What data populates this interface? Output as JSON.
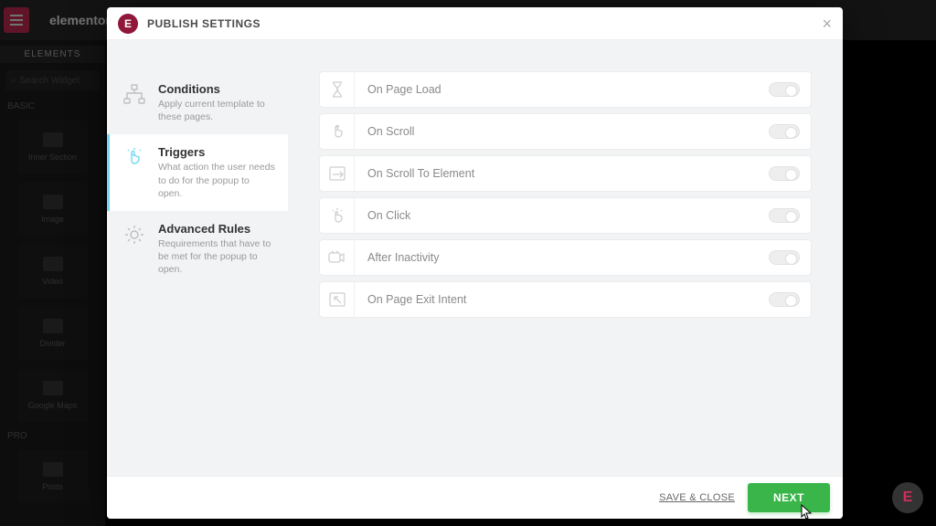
{
  "backdrop": {
    "brand": "elementor",
    "panel_tab": "ELEMENTS",
    "search_placeholder": "Search Widget",
    "cat_basic": "BASIC",
    "cat_pro": "PRO",
    "widgets_basic": [
      "Inner Section",
      "Image",
      "Video",
      "Divider",
      "Google Maps"
    ],
    "widgets_pro": [
      "Posts"
    ]
  },
  "modal": {
    "title": "PUBLISH SETTINGS"
  },
  "nav": [
    {
      "key": "conditions",
      "title": "Conditions",
      "desc": "Apply current template to these pages."
    },
    {
      "key": "triggers",
      "title": "Triggers",
      "desc": "What action the user needs to do for the popup to open."
    },
    {
      "key": "advanced-rules",
      "title": "Advanced Rules",
      "desc": "Requirements that have to be met for the popup to open."
    }
  ],
  "active_nav": "triggers",
  "triggers": [
    {
      "key": "page-load",
      "label": "On Page Load",
      "on": false
    },
    {
      "key": "scroll",
      "label": "On Scroll",
      "on": false
    },
    {
      "key": "scroll-element",
      "label": "On Scroll To Element",
      "on": false
    },
    {
      "key": "click",
      "label": "On Click",
      "on": false
    },
    {
      "key": "inactivity",
      "label": "After Inactivity",
      "on": false
    },
    {
      "key": "exit-intent",
      "label": "On Page Exit Intent",
      "on": false
    }
  ],
  "footer": {
    "save_close": "SAVE & CLOSE",
    "next": "NEXT"
  },
  "colors": {
    "brand_pink": "#D22E5A",
    "accent_blue": "#71D7F4",
    "next_green": "#39B54A"
  }
}
